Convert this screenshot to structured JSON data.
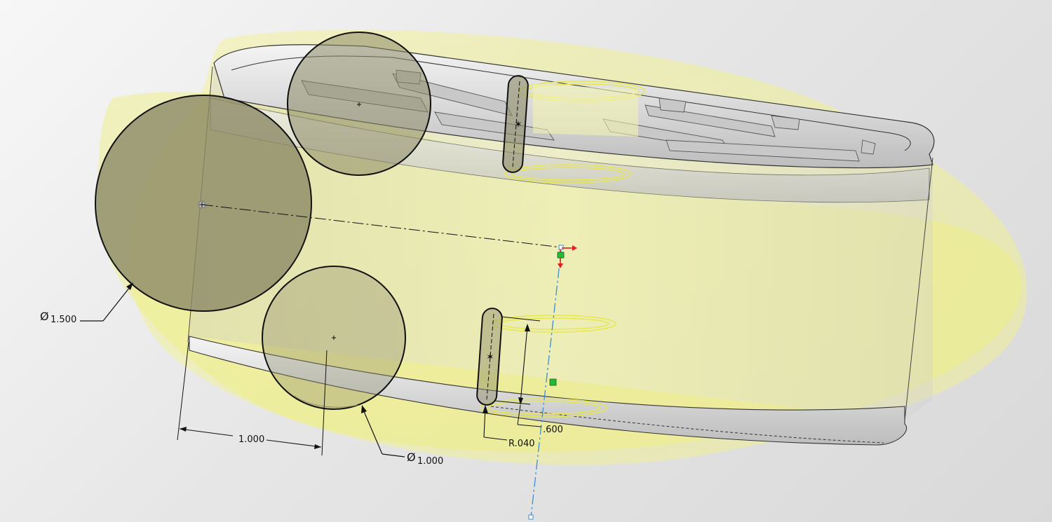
{
  "dimensions": {
    "diameter_large": {
      "symbol": "Ø",
      "value": "1.500"
    },
    "diameter_small": {
      "symbol": "Ø",
      "value": "1.000"
    },
    "horizontal_distance": {
      "value": "1.000"
    },
    "slot_height": {
      "value": ".600"
    },
    "slot_radius": {
      "value": "R.040"
    }
  },
  "colors": {
    "preview_yellow": "#f2f28a",
    "sketch_line": "#111111",
    "axis_blue": "#3d8bd6",
    "origin_red": "#e02020",
    "relation_green": "#22bb33",
    "body_gray": "#d8d8d8"
  },
  "icons": {
    "origin": "origin-triad-icon",
    "relation": "coincident-relation-icon"
  }
}
